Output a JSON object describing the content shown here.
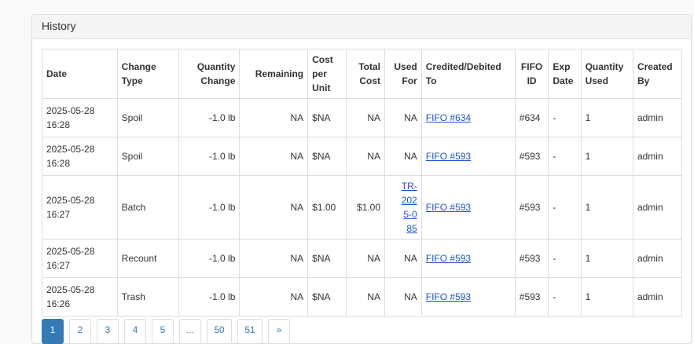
{
  "panel": {
    "title": "History"
  },
  "columns": {
    "date": "Date",
    "change_type": "Change Type",
    "quantity_change": "Quantity Change",
    "remaining": "Remaining",
    "cost_per_unit": "Cost per Unit",
    "total_cost": "Total Cost",
    "used_for": "Used For",
    "credited_debited_to": "Credited/Debited To",
    "fifo_id": "FIFO ID",
    "exp_date": "Exp Date",
    "quantity_used": "Quantity Used",
    "created_by": "Created By"
  },
  "rows": [
    {
      "date": "2025-05-28 16:28",
      "change_type": "Spoil",
      "quantity_change": "-1.0 lb",
      "remaining": "NA",
      "cost_per_unit": "$NA",
      "total_cost": "NA",
      "used_for": "NA",
      "credited_to": "FIFO #634",
      "fifo_id": "#634",
      "exp_date": "-",
      "quantity_used": "1",
      "created_by": "admin"
    },
    {
      "date": "2025-05-28 16:28",
      "change_type": "Spoil",
      "quantity_change": "-1.0 lb",
      "remaining": "NA",
      "cost_per_unit": "$NA",
      "total_cost": "NA",
      "used_for": "NA",
      "credited_to": "FIFO #593",
      "fifo_id": "#593",
      "exp_date": "-",
      "quantity_used": "1",
      "created_by": "admin"
    },
    {
      "date": "2025-05-28 16:27",
      "change_type": "Batch",
      "quantity_change": "-1.0 lb",
      "remaining": "NA",
      "cost_per_unit": "$1.00",
      "total_cost": "$1.00",
      "used_for": "TR-2025-085",
      "credited_to": "FIFO #593",
      "fifo_id": "#593",
      "exp_date": "-",
      "quantity_used": "1",
      "created_by": "admin"
    },
    {
      "date": "2025-05-28 16:27",
      "change_type": "Recount",
      "quantity_change": "-1.0 lb",
      "remaining": "NA",
      "cost_per_unit": "$NA",
      "total_cost": "NA",
      "used_for": "NA",
      "credited_to": "FIFO #593",
      "fifo_id": "#593",
      "exp_date": "-",
      "quantity_used": "1",
      "created_by": "admin"
    },
    {
      "date": "2025-05-28 16:26",
      "change_type": "Trash",
      "quantity_change": "-1.0 lb",
      "remaining": "NA",
      "cost_per_unit": "$NA",
      "total_cost": "NA",
      "used_for": "NA",
      "credited_to": "FIFO #593",
      "fifo_id": "#593",
      "exp_date": "-",
      "quantity_used": "1",
      "created_by": "admin"
    }
  ],
  "pagination": {
    "pages": [
      "1",
      "2",
      "3",
      "4",
      "5",
      "...",
      "50",
      "51",
      "»"
    ],
    "active": "1"
  },
  "colors": {
    "link": "#1a55cc",
    "active_page": "#337ab7"
  }
}
